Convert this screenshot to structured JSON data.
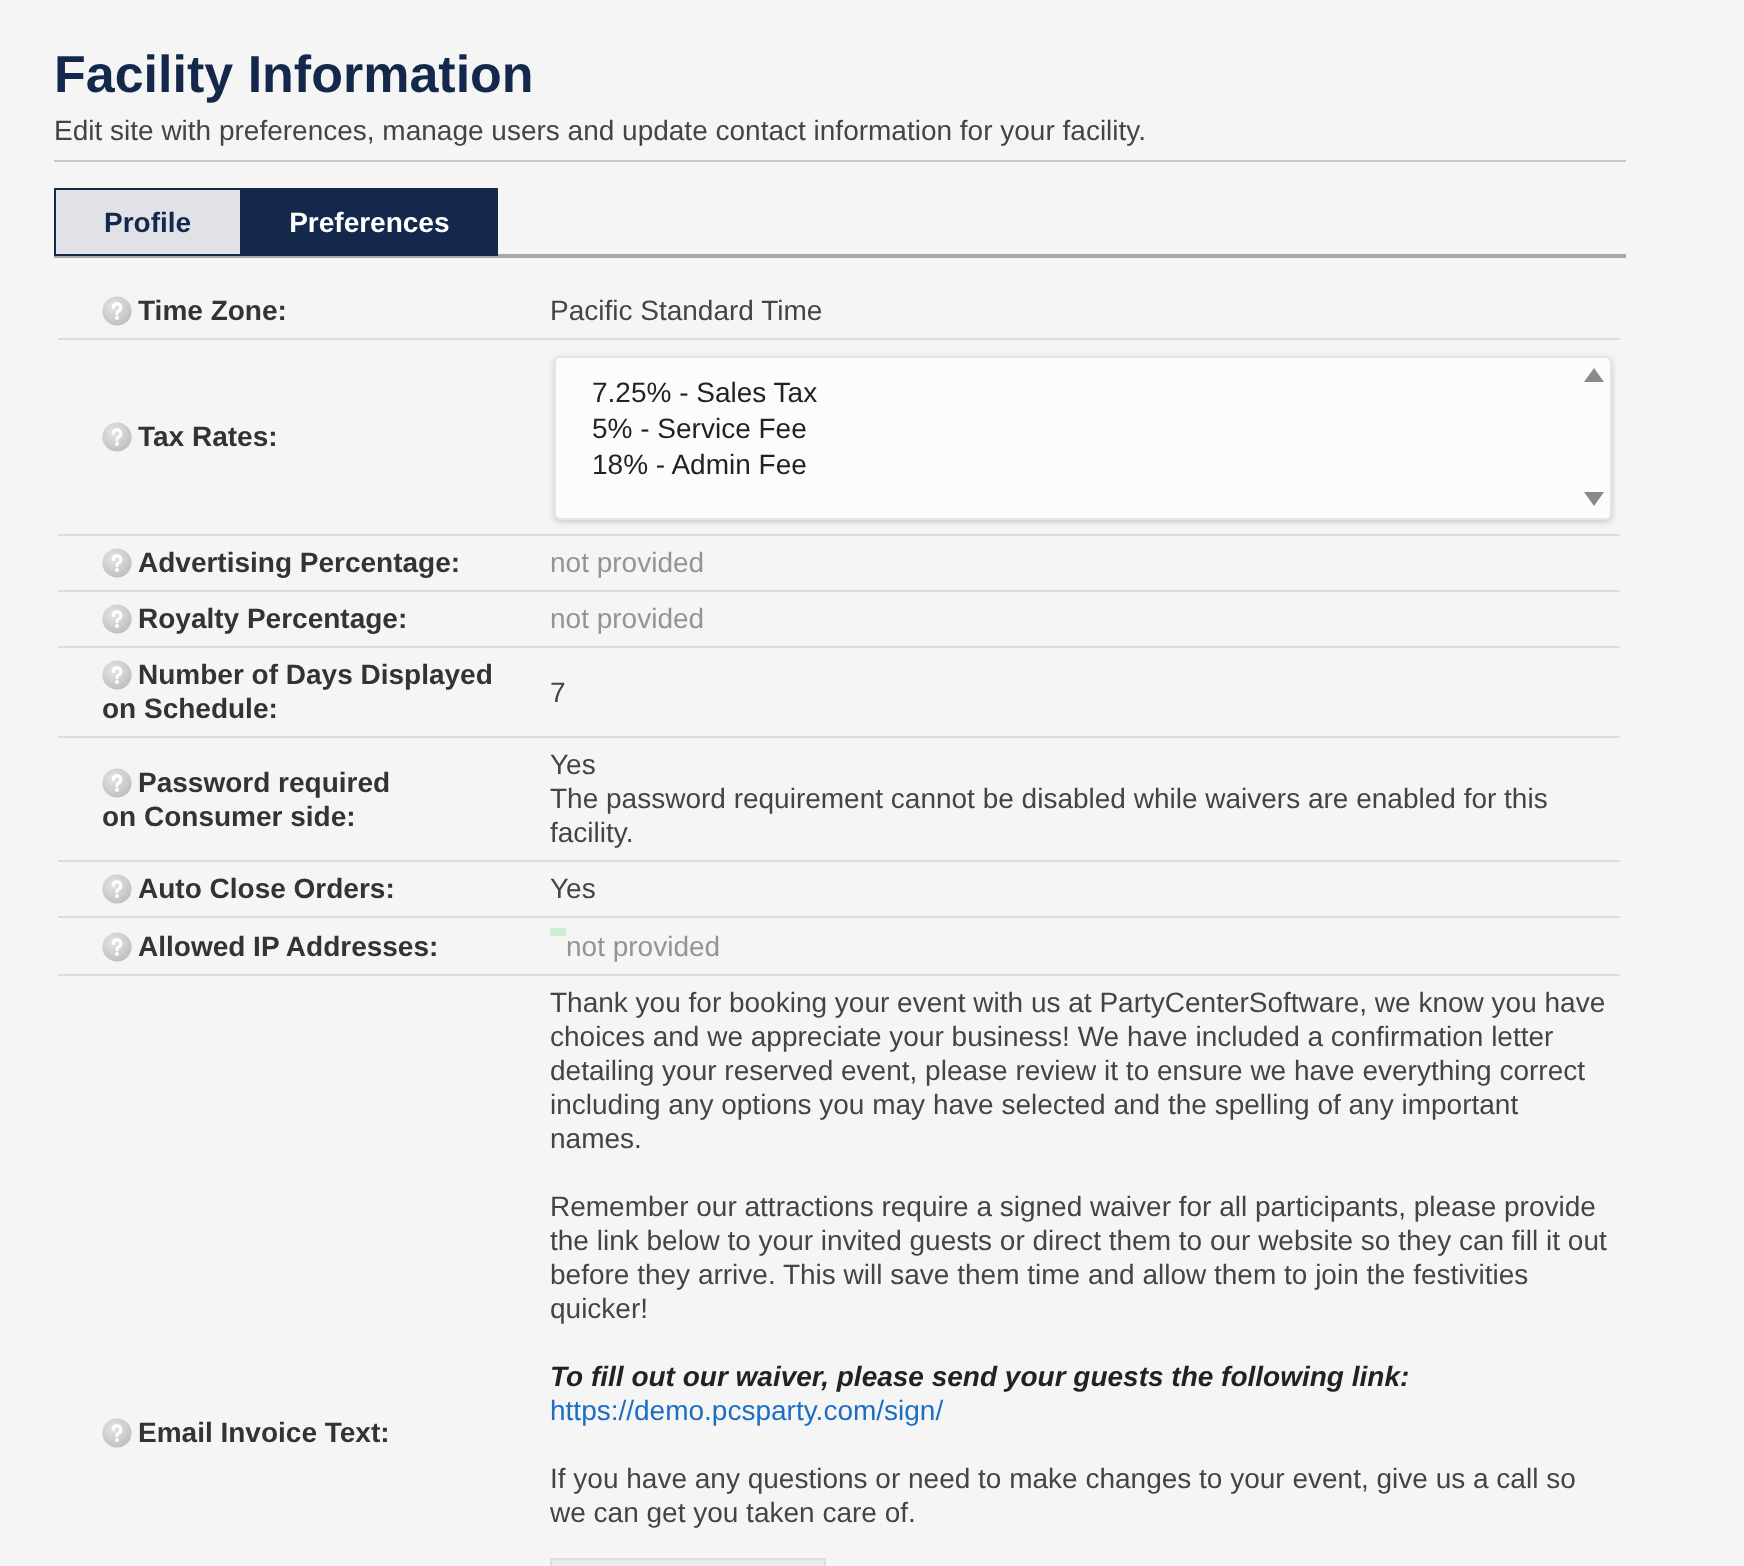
{
  "header": {
    "title": "Facility Information",
    "subtitle": "Edit site with preferences, manage users and update contact information for your facility."
  },
  "tabs": [
    {
      "label": "Profile",
      "selected": false
    },
    {
      "label": "Preferences",
      "selected": true
    }
  ],
  "settings": [
    {
      "kind": "text",
      "label": [
        "Time Zone:"
      ],
      "value": "Pacific Standard Time",
      "empty": false
    },
    {
      "kind": "list_box",
      "label": [
        "Tax Rates:"
      ],
      "lines": [
        "7.25% - Sales Tax",
        "5% - Service Fee",
        "18% - Admin Fee"
      ]
    },
    {
      "kind": "text",
      "label": [
        "Advertising Percentage:"
      ],
      "value": "not provided",
      "empty": true
    },
    {
      "kind": "text",
      "label": [
        "Royalty Percentage:"
      ],
      "value": "not provided",
      "empty": true
    },
    {
      "kind": "text",
      "label": [
        "Number of Days Displayed",
        "on Schedule:"
      ],
      "value": "7",
      "empty": false
    },
    {
      "kind": "text",
      "label": [
        "Password required",
        "on Consumer side:"
      ],
      "value": "Yes",
      "note": "The password requirement cannot be disabled while waivers are enabled for this facility.",
      "empty": false
    },
    {
      "kind": "text",
      "label": [
        "Auto Close Orders:"
      ],
      "value": "Yes",
      "empty": false
    },
    {
      "kind": "tagged_text",
      "label": [
        "Allowed IP Addresses:"
      ],
      "value": "not provided",
      "empty": true
    },
    {
      "kind": "message",
      "label": [
        "Email Invoice Text:"
      ],
      "paragraphs": [
        {
          "kind": "plain",
          "text": "Thank you for booking your event with us at PartyCenterSoftware, we know you have choices and we appreciate your business! We have included a confirmation letter detailing your reserved event, please review it to ensure we have everything correct including any options you may have selected and the spelling of any important names."
        },
        {
          "kind": "plain",
          "text": "Remember our attractions require a signed waiver for all participants, please provide the link below to your invited guests or direct them to our website so they can fill it out before they arrive. This will save them time and allow them to join the festivities quicker!"
        },
        {
          "kind": "emphasis",
          "text": "To fill out our waiver, please send your guests the following link:",
          "link": "https://demo.pcsparty.com/sign/"
        },
        {
          "kind": "plain",
          "text": "If you have any questions or need to make changes to your event, give us a call so we can get you taken care of."
        },
        {
          "kind": "image"
        }
      ]
    }
  ]
}
